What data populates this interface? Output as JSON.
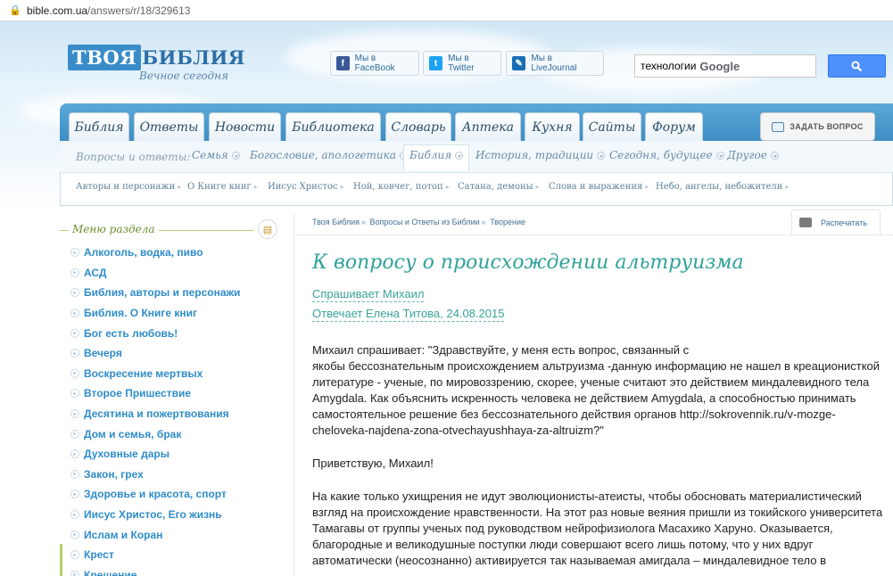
{
  "browser": {
    "url_host": "bible.com.ua",
    "url_path": "/answers/r/18/329613"
  },
  "header": {
    "logo_box": "ТВОЯ",
    "logo_word": "БИБЛИЯ",
    "tagline": "Вечное сегодня",
    "social": [
      {
        "label": "Мы в FaceBook",
        "icon": "facebook-icon",
        "color": "#3b5998"
      },
      {
        "label": "Мы в Twitter",
        "icon": "twitter-icon",
        "color": "#1da1f2"
      },
      {
        "label": "Мы в LiveJournal",
        "icon": "livejournal-icon",
        "color": "#1a6fb4"
      }
    ],
    "search": {
      "value": "технологии",
      "brand": "Google"
    }
  },
  "tabs": [
    "Библия",
    "Ответы",
    "Новости",
    "Библиотека",
    "Словарь",
    "Аптека",
    "Кухня",
    "Сайты",
    "Форум"
  ],
  "ask_button": "ЗАДАТЬ ВОПРОС",
  "subnav1": {
    "label": "Вопросы и ответы:",
    "items": [
      "Семья",
      "Богословие, апологетика",
      "Библия",
      "История, традиции",
      "Сегодня, будущее",
      "Другое"
    ],
    "active": "Библия"
  },
  "subnav2": [
    "Авторы и персонажи",
    "О Книге книг",
    "Иисус Христос",
    "Ной, ковчег, потоп",
    "Сатана, демоны",
    "Слова и выражения",
    "Небо, ангелы, небожители"
  ],
  "sidebar": {
    "title": "Меню раздела",
    "items": [
      "Алкоголь, водка, пиво",
      "АСД",
      "Библия, авторы и персонажи",
      "Библия. О Книге книг",
      "Бог есть любовь!",
      "Вечеря",
      "Воскресение мертвых",
      "Второе Пришествие",
      "Десятина и пожертвования",
      "Дом и семья, брак",
      "Духовные дары",
      "Закон, грех",
      "Здоровье и красота, спорт",
      "Иисус Христос, Его жизнь",
      "Ислам и Коран",
      "Крест",
      "Крещение"
    ]
  },
  "breadcrumbs": [
    "Твоя Библия",
    "Вопросы и Ответы из Библии",
    "Творение"
  ],
  "print_label": "Распечатать",
  "article": {
    "title": "К вопросу о происхождении альтруизма",
    "asks": "Спрашивает Михаил",
    "answers": "Отвечает Елена Титова, 24.08.2015",
    "paragraphs": [
      "Михаил спрашивает: \"Здравствуйте, у меня есть вопрос, связанный с\nякобы бессознательным происхождением альтруизма -данную информацию не нашел в креационисткой литературе - ученые, по мировоззрению, скорее, ученые считают это действием миндалевидного тела Amygdala. Как объяснить искренность человека не действием Amygdala, а способностью принимать самостоятельное решение без бессознательного действия органов http://sokrovennik.ru/v-mozge- cheloveka-najdena-zona-otvechayushhaya-za-altruizm?\"",
      "Приветствую, Михаил!",
      "На какие только ухищрения не идут эволюционисты-атеисты, чтобы обосновать материалистический взгляд на происхождение нравственности. На этот раз новые веяния пришли из токийского университета Тамагавы от группы ученых под руководством нейрофизиолога Масахико Харуно. Оказывается, благородные и великодушные поступки люди совершают всего лишь потому, что у них вдруг автоматически (неосознанно) активируется так называемая амигдала – миндалевидное тело в"
    ]
  }
}
